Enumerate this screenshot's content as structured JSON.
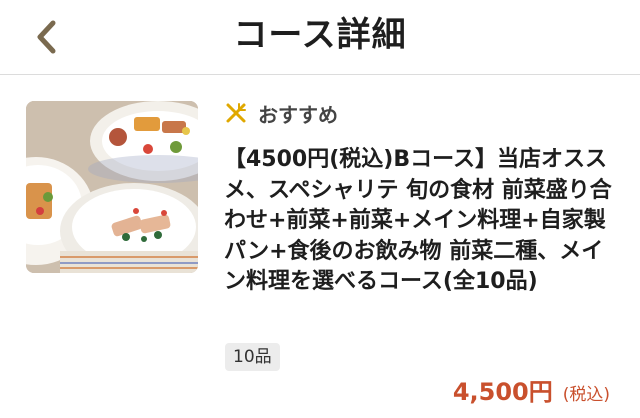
{
  "header": {
    "title": "コース詳細",
    "back_icon": "chevron-left-icon",
    "accent_color": "#7a6a4f"
  },
  "course": {
    "recommend_icon": "fork-knife-cross-icon",
    "recommend_label": "おすすめ",
    "title": "【4500円(税込)Bコース】当店オススメ、スペシャリテ 旬の食材 前菜盛り合わせ+前菜+前菜+メイン料理+自家製パン+食後のお飲み物 前菜二種、メイン料理を選べるコース(全10品)",
    "item_count": "10品",
    "price": "4,500円",
    "price_tax_note": "(税込)",
    "price_color": "#c9502d"
  }
}
